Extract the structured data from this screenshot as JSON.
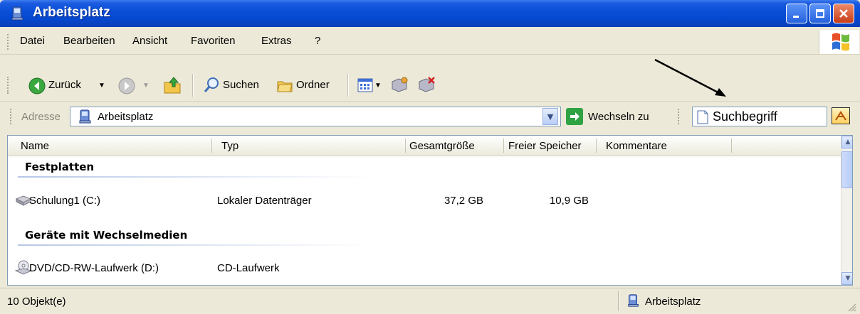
{
  "window": {
    "title": "Arbeitsplatz"
  },
  "menu": {
    "items": [
      "Datei",
      "Bearbeiten",
      "Ansicht",
      "Favoriten",
      "Extras",
      "?"
    ]
  },
  "toolbar": {
    "back_label": "Zurück",
    "search_label": "Suchen",
    "folders_label": "Ordner"
  },
  "address": {
    "label": "Adresse",
    "value": "Arbeitsplatz",
    "go_label": "Wechseln zu"
  },
  "search": {
    "value": "Suchbegriff"
  },
  "list": {
    "columns": [
      "Name",
      "Typ",
      "Gesamtgröße",
      "Freier Speicher",
      "Kommentare"
    ],
    "groups": [
      {
        "title": "Festplatten",
        "rows": [
          {
            "name": "Schulung1 (C:)",
            "type": "Lokaler Datenträger",
            "total": "37,2 GB",
            "free": "10,9 GB",
            "icon": "hard-drive-icon"
          }
        ]
      },
      {
        "title": "Geräte mit Wechselmedien",
        "rows": [
          {
            "name": "DVD/CD-RW-Laufwerk (D:)",
            "type": "CD-Laufwerk",
            "total": "",
            "free": "",
            "icon": "cd-drive-icon"
          }
        ]
      }
    ]
  },
  "status": {
    "count": "10 Objekt(e)",
    "location": "Arbeitsplatz"
  },
  "colors": {
    "titlebar": "#0548CF",
    "chrome": "#ECE9D8",
    "border": "#7f9db9"
  }
}
